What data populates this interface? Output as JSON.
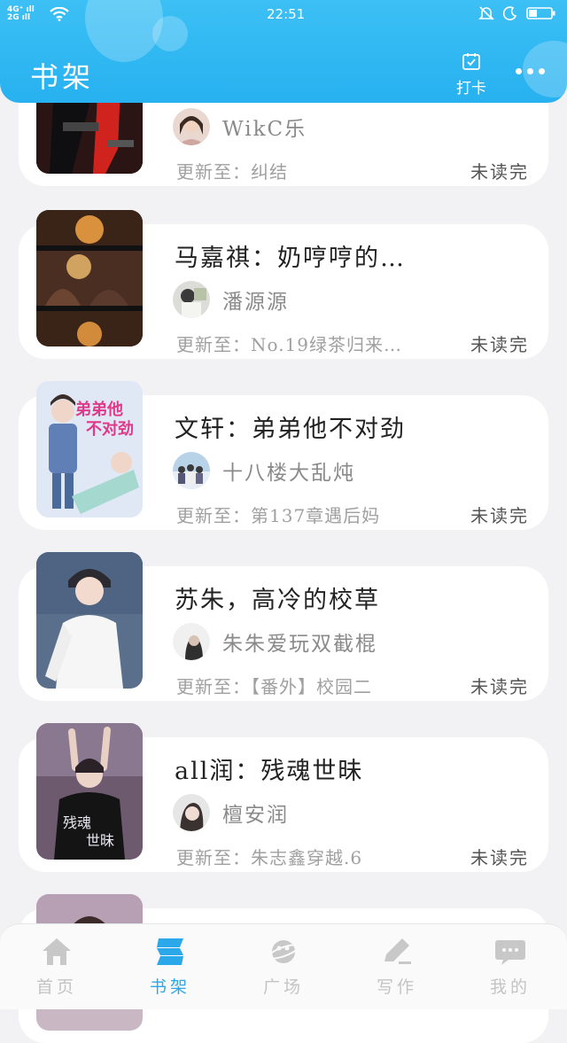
{
  "status_bar": {
    "network_top": "4G⁺",
    "network_bottom": "2G",
    "time": "22:51"
  },
  "header": {
    "title": "书架",
    "checkin_label": "打卡",
    "more_icon": "more-dots-icon"
  },
  "books": [
    {
      "title": "",
      "author": "WikC乐",
      "update": "更新至：纠结",
      "status": "未读完"
    },
    {
      "title": "马嘉祺：奶哼哼的…",
      "author": "潘源源",
      "update": "更新至：No.19绿茶归来…",
      "status": "未读完"
    },
    {
      "title": "文轩：弟弟他不对劲",
      "author": "十八楼大乱炖",
      "update": "更新至：第137章遇后妈",
      "status": "未读完"
    },
    {
      "title": "苏朱，高冷的校草",
      "author": "朱朱爱玩双截棍",
      "update": "更新至：【番外】校园二",
      "status": "未读完"
    },
    {
      "title": "all润：残魂世昧",
      "author": "檀安润",
      "update": "更新至：朱志鑫穿越.6",
      "status": "未读完"
    }
  ],
  "cover_texts": {
    "book3": "弟弟他不对劲",
    "book5": "残魂世昧"
  },
  "tabs": [
    {
      "label": "首页",
      "icon": "home-icon",
      "active": false
    },
    {
      "label": "书架",
      "icon": "bookshelf-icon",
      "active": true
    },
    {
      "label": "广场",
      "icon": "planet-icon",
      "active": false
    },
    {
      "label": "写作",
      "icon": "pen-icon",
      "active": false
    },
    {
      "label": "我的",
      "icon": "chat-bubble-icon",
      "active": false
    }
  ],
  "colors": {
    "header_blue": "#2bb4f1",
    "active_tab": "#2aa8ea",
    "inactive_tab": "#c4c4c4"
  }
}
